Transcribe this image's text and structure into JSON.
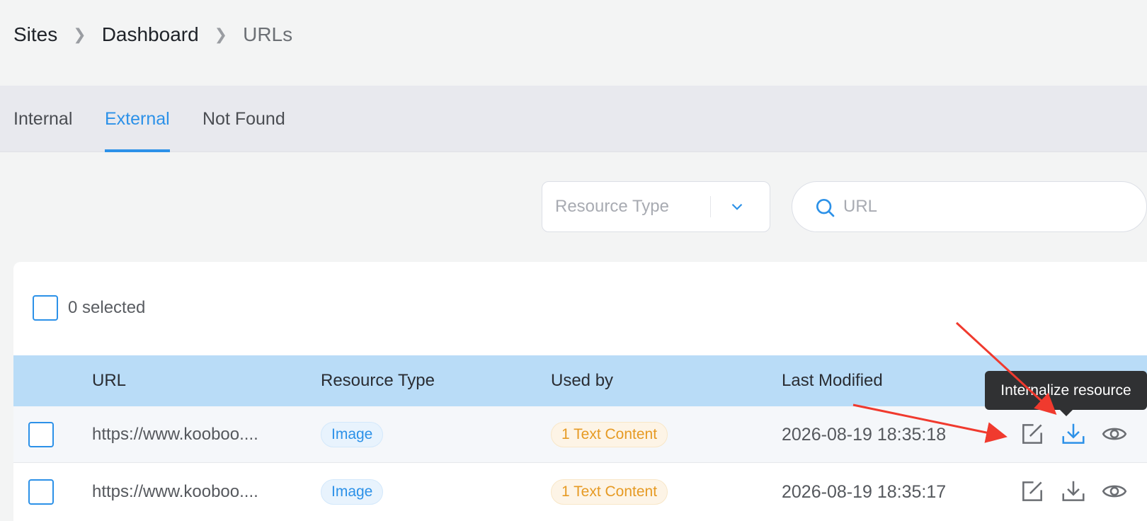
{
  "breadcrumb": {
    "items": [
      "Sites",
      "Dashboard",
      "URLs"
    ]
  },
  "tabs": [
    {
      "label": "Internal",
      "active": false
    },
    {
      "label": "External",
      "active": true
    },
    {
      "label": "Not Found",
      "active": false
    }
  ],
  "filters": {
    "resource_type_placeholder": "Resource Type",
    "search_placeholder": "URL"
  },
  "selection": {
    "label": "0 selected"
  },
  "table": {
    "columns": [
      "URL",
      "Resource Type",
      "Used by",
      "Last Modified"
    ],
    "rows": [
      {
        "url": "https://www.kooboo....",
        "resource_type": "Image",
        "used_by": "1 Text Content",
        "last_modified": "2026-08-19 18:35:18",
        "highlighted": true
      },
      {
        "url": "https://www.kooboo....",
        "resource_type": "Image",
        "used_by": "1 Text Content",
        "last_modified": "2026-08-19 18:35:17",
        "highlighted": false
      }
    ],
    "actions": [
      "edit-icon",
      "download-icon",
      "eye-icon"
    ]
  },
  "tooltip": {
    "text": "Internalize resource"
  },
  "colors": {
    "accent": "#2c91e8",
    "header_row": "#b9dcf7",
    "annotation_arrow": "#f03a2e",
    "tag_orange": "#e69a23"
  }
}
